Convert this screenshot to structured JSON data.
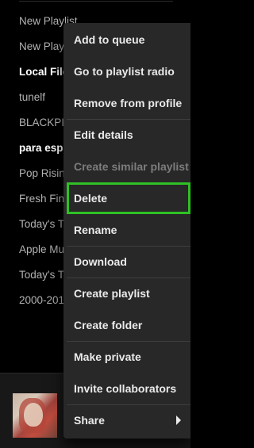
{
  "sidebar": {
    "playlists": [
      {
        "label": "New Playlist",
        "bold": false
      },
      {
        "label": "New Playlist",
        "bold": false
      },
      {
        "label": "Local Files",
        "bold": true
      },
      {
        "label": "tunelf",
        "bold": false
      },
      {
        "label": "BLACKPINK",
        "bold": false
      },
      {
        "label": "para espanol",
        "bold": true
      },
      {
        "label": "Pop Rising",
        "bold": false
      },
      {
        "label": "Fresh Finds",
        "bold": false
      },
      {
        "label": "Today's Top Hits",
        "bold": false
      },
      {
        "label": "Apple Music",
        "bold": false
      },
      {
        "label": "Today's Top Hits",
        "bold": false
      },
      {
        "label": "2000-2010",
        "bold": false
      }
    ]
  },
  "context_menu": {
    "items": [
      {
        "label": "Add to queue"
      },
      {
        "label": "Go to playlist radio"
      },
      {
        "label": "Remove from profile"
      },
      {
        "label": "Edit details"
      },
      {
        "label": "Create similar playlist",
        "disabled": true
      },
      {
        "label": "Delete",
        "highlighted": true
      },
      {
        "label": "Rename"
      },
      {
        "label": "Download"
      },
      {
        "label": "Create playlist"
      },
      {
        "label": "Create folder"
      },
      {
        "label": "Make private"
      },
      {
        "label": "Invite collaborators"
      },
      {
        "label": "Share",
        "submenu": true
      }
    ],
    "submenu_icon": "chevron-right-icon",
    "highlight_color": "#2fc125"
  },
  "now_playing": {
    "album_art": "album-art"
  },
  "colors": {
    "background": "#000000",
    "menu_background": "#282828",
    "menu_text": "#eaeaea",
    "disabled_text": "#7c7c7c",
    "sidebar_text": "#b3b3b3",
    "highlight": "#2fc125"
  }
}
